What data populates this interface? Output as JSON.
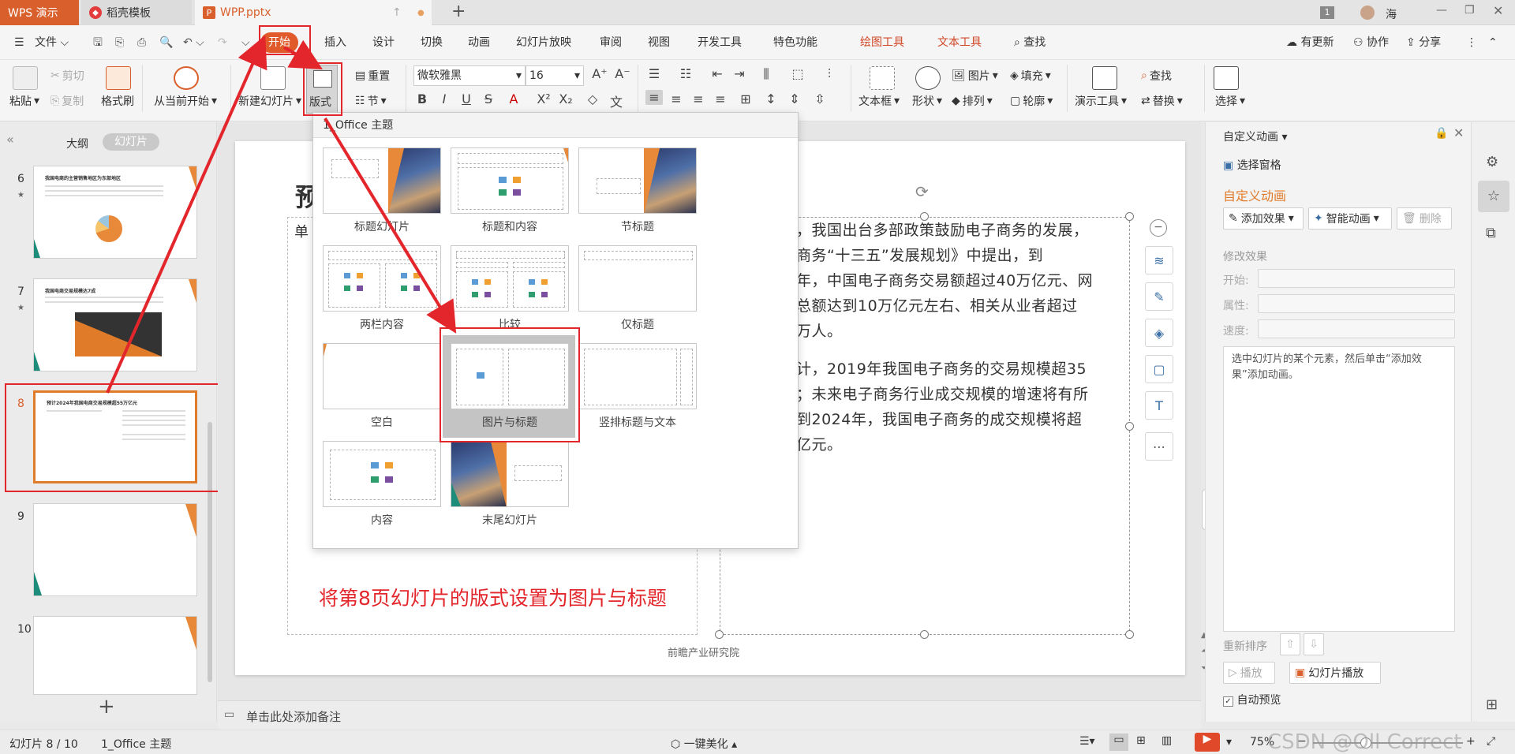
{
  "titlebar": {
    "app_tab": "WPS 演示",
    "tab2": "稻壳模板",
    "tab3": "WPP.pptx",
    "badge": "1",
    "user": "海"
  },
  "menu": {
    "file": "文件",
    "items": [
      "开始",
      "插入",
      "设计",
      "切换",
      "动画",
      "幻灯片放映",
      "审阅",
      "视图",
      "开发工具",
      "特色功能"
    ],
    "tool_items": [
      "绘图工具",
      "文本工具"
    ],
    "search": "查找",
    "update": "有更新",
    "collab": "协作",
    "share": "分享"
  },
  "ribbon": {
    "paste": "粘贴",
    "cut": "剪切",
    "copy": "复制",
    "format_painter": "格式刷",
    "play_from_current": "从当前开始",
    "new_slide": "新建幻灯片",
    "layout": "版式",
    "reset": "重置",
    "section": "节",
    "font_name": "微软雅黑",
    "font_size": "16",
    "text_box": "文本框",
    "shape": "形状",
    "picture": "图片",
    "fill": "填充",
    "arrange": "排列",
    "outline": "轮廓",
    "present_tools": "演示工具",
    "find": "查找",
    "replace": "替换",
    "select": "选择"
  },
  "left_pane": {
    "outline_tab": "大纲",
    "slides_tab": "幻灯片",
    "slide_numbers": [
      "6",
      "7",
      "8",
      "9",
      "10"
    ],
    "slide_titles": [
      "我国电商的主营销售地区为东部地区",
      "我国电商交易规模达7成",
      "预计2024年我国电商交易规模超55万亿元"
    ],
    "add": "+"
  },
  "layout_popup": {
    "header": "1_Office 主题",
    "items": [
      "标题幻灯片",
      "标题和内容",
      "节标题",
      "两栏内容",
      "比较",
      "仅标题",
      "空白",
      "图片与标题",
      "竖排标题与文本",
      "内容",
      "末尾幻灯片"
    ]
  },
  "slide": {
    "title_fragment": "预",
    "left_fragment": "单",
    "body_p1": "，我国出台多部政策鼓励电子商务的发展，商务“十三五”发展规划》中提出，到年，中国电子商务交易额超过40万亿元、网总额达到10万亿元左右、相关从业者超过万人。",
    "body_lines_p1": [
      "，我国出台多部政策鼓励电子商务的发展，",
      "商务“十三五”发展规划》中提出，到",
      "年，中国电子商务交易额超过40万亿元、网",
      "总额达到10万亿元左右、相关从业者超过",
      "万人。"
    ],
    "body_lines_p2": [
      "计，2019年我国电子商务的交易规模超35",
      "；未来电子商务行业成交规模的增速将有所",
      "到2024年，我国电子商务的成交规模将超",
      "亿元。"
    ],
    "source": "前瞻产业研究院",
    "annotation": "将第8页幻灯片的版式设置为图片与标题"
  },
  "right_panel": {
    "title": "自定义动画",
    "select_pane": "选择窗格",
    "section_title": "自定义动画",
    "add_effect": "添加效果",
    "smart_anim": "智能动画",
    "delete": "删除",
    "modify_effect": "修改效果",
    "start_label": "开始:",
    "property_label": "属性:",
    "speed_label": "速度:",
    "hint": "选中幻灯片的某个元素，然后单击“添加效果”添加动画。",
    "reorder": "重新排序",
    "play": "播放",
    "slideshow": "幻灯片播放",
    "auto_preview": "自动预览"
  },
  "notes": {
    "placeholder": "单击此处添加备注"
  },
  "status": {
    "slide_pos": "幻灯片 8 / 10",
    "theme": "1_Office 主题",
    "beautify": "一键美化",
    "zoom": "75%",
    "watermark": "CSDN @Oll Correct"
  },
  "colors": {
    "accent": "#e3262b",
    "brand_orange": "#d9602c",
    "tool_tab": "#d24726"
  }
}
